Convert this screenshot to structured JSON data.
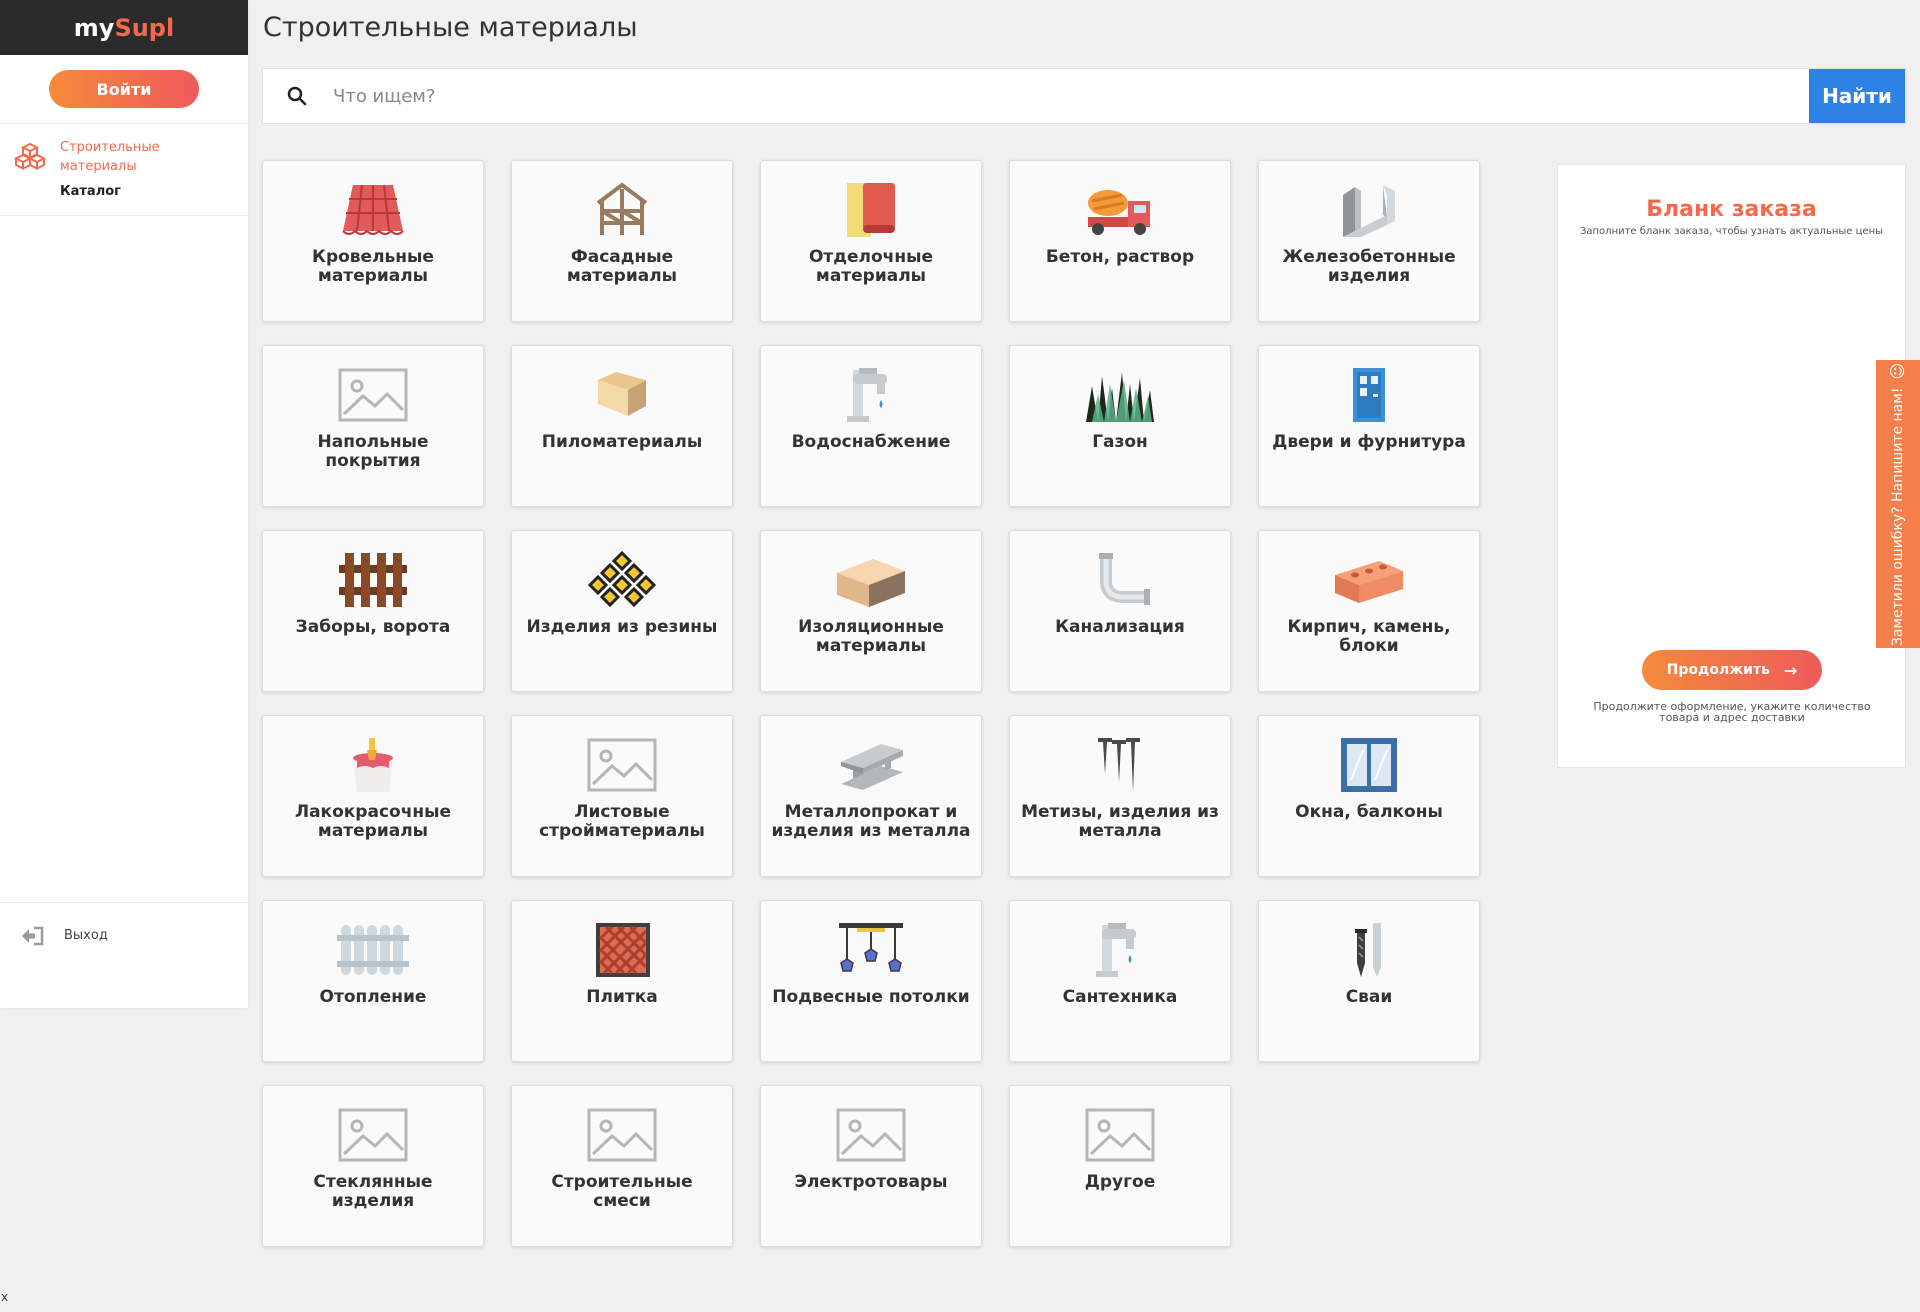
{
  "brand": {
    "part1": "my",
    "part2": "Supl"
  },
  "sidebar": {
    "login_label": "Войти",
    "category_label": "Строительные материалы",
    "catalog_label": "Каталог",
    "logout_label": "Выход"
  },
  "header": {
    "title": "Строительные материалы"
  },
  "search": {
    "placeholder": "Что ищем?",
    "button_label": "Найти"
  },
  "categories": [
    {
      "label": "Кровельные материалы",
      "icon": "roof-icon"
    },
    {
      "label": "Фасадные материалы",
      "icon": "facade-frame-icon"
    },
    {
      "label": "Отделочные материалы",
      "icon": "finishing-icon"
    },
    {
      "label": "Бетон, раствор",
      "icon": "concrete-mixer-icon"
    },
    {
      "label": "Железобетонные изделия",
      "icon": "reinforced-concrete-icon"
    },
    {
      "label": "Напольные покрытия",
      "icon": "image-placeholder-icon"
    },
    {
      "label": "Пиломатериалы",
      "icon": "lumber-icon"
    },
    {
      "label": "Водоснабжение",
      "icon": "faucet-icon"
    },
    {
      "label": "Газон",
      "icon": "grass-icon"
    },
    {
      "label": "Двери и фурнитура",
      "icon": "door-icon"
    },
    {
      "label": "Заборы, ворота",
      "icon": "fence-icon"
    },
    {
      "label": "Изделия из резины",
      "icon": "rubber-grid-icon"
    },
    {
      "label": "Изоляционные материалы",
      "icon": "insulation-block-icon"
    },
    {
      "label": "Канализация",
      "icon": "pipe-icon"
    },
    {
      "label": "Кирпич, камень, блоки",
      "icon": "brick-icon"
    },
    {
      "label": "Лакокрасочные материалы",
      "icon": "paint-bucket-icon"
    },
    {
      "label": "Листовые стройматериалы",
      "icon": "image-placeholder-icon"
    },
    {
      "label": "Металлопрокат и изделия из металла",
      "icon": "steel-beam-icon"
    },
    {
      "label": "Метизы, изделия из металла",
      "icon": "nails-icon"
    },
    {
      "label": "Окна, балконы",
      "icon": "window-icon"
    },
    {
      "label": "Отопление",
      "icon": "radiator-icon"
    },
    {
      "label": "Плитка",
      "icon": "tile-icon"
    },
    {
      "label": "Подвесные потолки",
      "icon": "ceiling-lamps-icon"
    },
    {
      "label": "Сантехника",
      "icon": "faucet-icon"
    },
    {
      "label": "Сваи",
      "icon": "piles-icon"
    },
    {
      "label": "Стеклянные изделия",
      "icon": "image-placeholder-icon"
    },
    {
      "label": "Строительные смеси",
      "icon": "image-placeholder-icon"
    },
    {
      "label": "Электротовары",
      "icon": "image-placeholder-icon"
    },
    {
      "label": "Другое",
      "icon": "image-placeholder-icon"
    }
  ],
  "order_form": {
    "title": "Бланк заказа",
    "subtitle": "Заполните бланк заказа, чтобы узнать актуальные цены",
    "continue_label": "Продолжить",
    "note": "Продолжите оформление, укажите количество товара и адрес доставки"
  },
  "feedback": {
    "label": "Заметили ошибку? Напишите нам!"
  },
  "corner_text": "x",
  "colors": {
    "accent": "#f26a4b",
    "primary_button": "#2e82e6",
    "sidebar_dark": "#2b2b2b"
  }
}
